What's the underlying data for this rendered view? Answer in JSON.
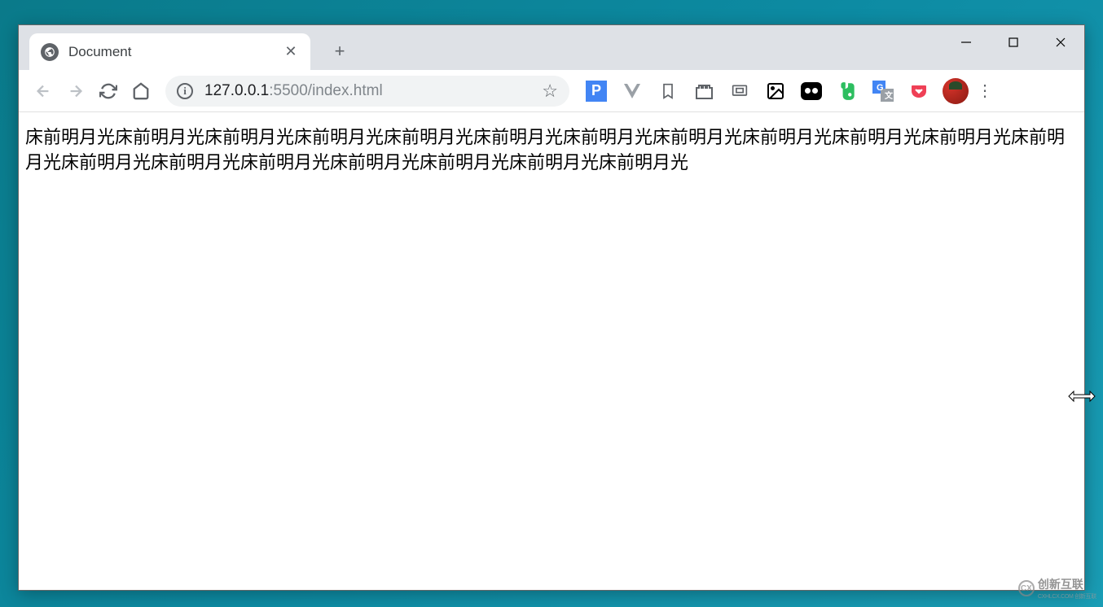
{
  "tab": {
    "title": "Document"
  },
  "url": {
    "host": "127.0.0.1",
    "port_path": ":5500/index.html"
  },
  "content": {
    "text": "床前明月光床前明月光床前明月光床前明月光床前明月光床前明月光床前明月光床前明月光床前明月光床前明月光床前明月光床前明月光床前明月光床前明月光床前明月光床前明月光床前明月光床前明月光床前明月光"
  },
  "watermark": {
    "main": "创新互联",
    "sub": "CXHLCX.COM 创新互联"
  }
}
